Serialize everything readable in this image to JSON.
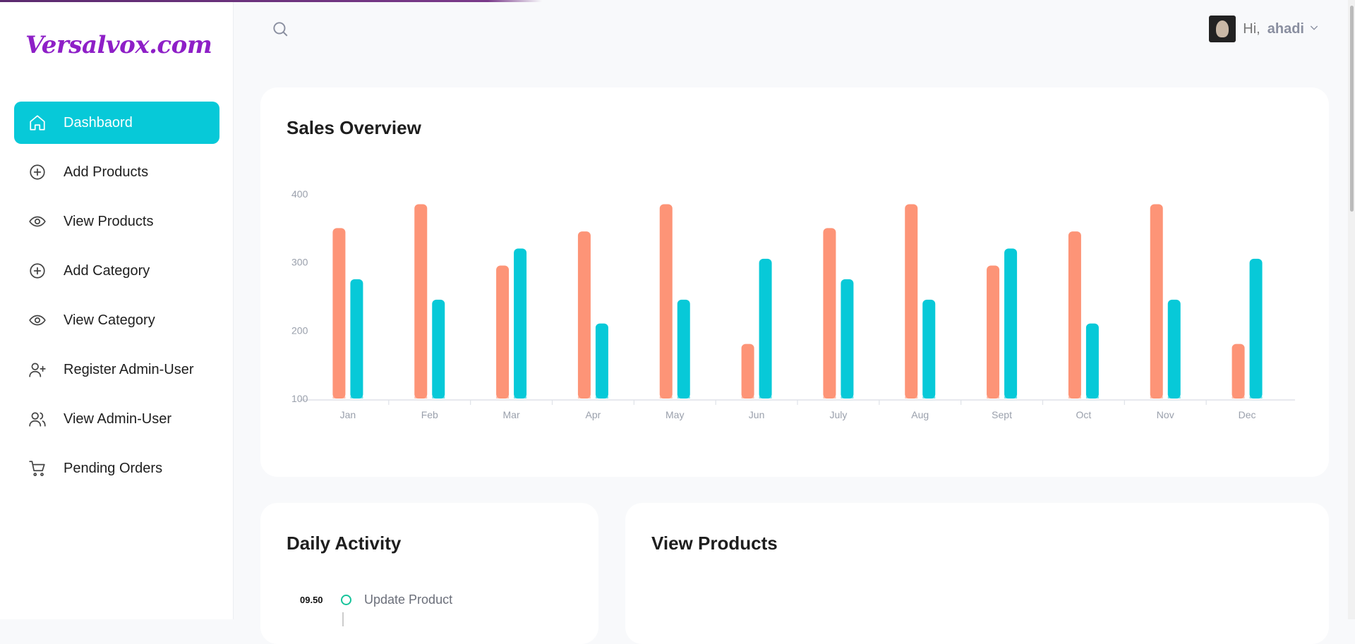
{
  "brand": {
    "logo": "Versalvox.com",
    "logo_color": "#8e1fc7"
  },
  "sidebar": {
    "items": [
      {
        "label": "Dashbaord",
        "icon": "home-icon",
        "active": true
      },
      {
        "label": "Add Products",
        "icon": "plus-circle-icon",
        "active": false
      },
      {
        "label": "View Products",
        "icon": "eye-icon",
        "active": false
      },
      {
        "label": "Add Category",
        "icon": "plus-circle-icon",
        "active": false
      },
      {
        "label": "View Category",
        "icon": "eye-icon",
        "active": false
      },
      {
        "label": "Register Admin-User",
        "icon": "user-plus-icon",
        "active": false
      },
      {
        "label": "View Admin-User",
        "icon": "users-icon",
        "active": false
      },
      {
        "label": "Pending Orders",
        "icon": "cart-icon",
        "active": false
      }
    ]
  },
  "header": {
    "greeting": "Hi,",
    "username": "ahadi"
  },
  "sales": {
    "title": "Sales Overview",
    "chart_data": {
      "type": "bar",
      "categories": [
        "Jan",
        "Feb",
        "Mar",
        "Apr",
        "May",
        "Jun",
        "July",
        "Aug",
        "Sept",
        "Oct",
        "Nov",
        "Dec"
      ],
      "series": [
        {
          "color": "#fd9477",
          "values": [
            350,
            385,
            295,
            345,
            385,
            180,
            350,
            385,
            295,
            345,
            385,
            180
          ]
        },
        {
          "color": "#07c9d8",
          "values": [
            275,
            245,
            320,
            210,
            245,
            305,
            275,
            245,
            320,
            210,
            245,
            305
          ]
        }
      ],
      "yticks": [
        100,
        200,
        300,
        400
      ],
      "ylim": [
        100,
        400
      ],
      "grid": false
    }
  },
  "daily": {
    "title": "Daily Activity",
    "items": [
      {
        "time": "09.50",
        "label": "Update Product"
      }
    ]
  },
  "products": {
    "title": "View Products"
  },
  "colors": {
    "accent": "#07c9d8",
    "bar_orange": "#fd9477",
    "activity_dot": "#17c49b"
  }
}
